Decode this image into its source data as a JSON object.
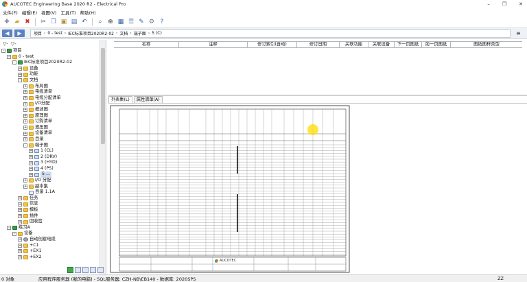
{
  "window": {
    "title": "AUCOTEC Engineering Base 2020 R2 - Electrical Pro",
    "controls": [
      "–",
      "❐",
      "✕"
    ]
  },
  "menu": [
    "文件(F)",
    "编辑(E)",
    "视图(V)",
    "工具(T)",
    "帮助(H)"
  ],
  "toolbar_icons": [
    "new-icon",
    "open-icon",
    "delete-icon",
    "cut-icon",
    "copy-icon",
    "paste-icon",
    "properties-icon",
    "undo-icon",
    "search-icon",
    "zoom-icon",
    "view-icon",
    "list-icon",
    "help-icon"
  ],
  "address": {
    "crumbs": [
      "项目",
      "0 - test",
      "IEC标准项目2020R2-02",
      "文档",
      "端子图",
      "5 (C)"
    ],
    "end_glyph": "≡"
  },
  "tree": {
    "toolbar": [
      "▽-",
      "▽-"
    ],
    "items": [
      {
        "label": "项目",
        "level": 0,
        "exp": "-",
        "icon": "proj"
      },
      {
        "label": "0 - test",
        "level": 1,
        "exp": "-",
        "icon": "folder"
      },
      {
        "label": "IEC标准项目2020R2-02",
        "level": 2,
        "exp": "-",
        "icon": "proj"
      },
      {
        "label": "设备",
        "level": 3,
        "exp": "+",
        "icon": "folder"
      },
      {
        "label": "功能",
        "level": 3,
        "exp": "+",
        "icon": "folder"
      },
      {
        "label": "文档",
        "level": 3,
        "exp": "-",
        "icon": "folder"
      },
      {
        "label": "布局图",
        "level": 4,
        "exp": "+",
        "icon": "folder"
      },
      {
        "label": "电缆清单",
        "level": 4,
        "exp": "+",
        "icon": "folder"
      },
      {
        "label": "电缆分配清单",
        "level": 4,
        "exp": "+",
        "icon": "folder"
      },
      {
        "label": "I/O分配",
        "level": 4,
        "exp": "+",
        "icon": "folder"
      },
      {
        "label": "概述图",
        "level": 4,
        "exp": "+",
        "icon": "folder"
      },
      {
        "label": "原理图",
        "level": 4,
        "exp": "+",
        "icon": "folder"
      },
      {
        "label": "订购清单",
        "level": 4,
        "exp": "+",
        "icon": "folder"
      },
      {
        "label": "液压图",
        "level": 4,
        "exp": "+",
        "icon": "folder"
      },
      {
        "label": "设备清单",
        "level": 4,
        "exp": "+",
        "icon": "folder"
      },
      {
        "label": "目录",
        "level": 4,
        "exp": "+",
        "icon": "folder"
      },
      {
        "label": "端子图",
        "level": 4,
        "exp": "-",
        "icon": "folder"
      },
      {
        "label": "1 (CL)",
        "level": 5,
        "exp": "+",
        "icon": "page"
      },
      {
        "label": "2 (DRV)",
        "level": 5,
        "exp": "+",
        "icon": "page"
      },
      {
        "label": "3 (HYD)",
        "level": 5,
        "exp": "+",
        "icon": "page"
      },
      {
        "label": "4 (PS)",
        "level": 5,
        "exp": "+",
        "icon": "page"
      },
      {
        "label": "5 ...",
        "level": 5,
        "exp": "+",
        "icon": "page",
        "selected": true
      },
      {
        "label": "I/O 分配",
        "level": 4,
        "exp": "+",
        "icon": "folder"
      },
      {
        "label": "副本集",
        "level": 4,
        "exp": "+",
        "icon": "folder"
      },
      {
        "label": "目录 1.1A",
        "level": 4,
        "exp": "",
        "icon": "doc"
      },
      {
        "label": "任务",
        "level": 3,
        "exp": "+",
        "icon": "folder"
      },
      {
        "label": "信息",
        "level": 3,
        "exp": "+",
        "icon": "folder"
      },
      {
        "label": "模板",
        "level": 3,
        "exp": "+",
        "icon": "folder"
      },
      {
        "label": "插件",
        "level": 3,
        "exp": "+",
        "icon": "folder"
      },
      {
        "label": "回收篮",
        "level": 3,
        "exp": "+",
        "icon": "folder"
      },
      {
        "label": "练习A",
        "level": 1,
        "exp": "-",
        "icon": "proj"
      },
      {
        "label": "设备",
        "level": 2,
        "exp": "-",
        "icon": "folder"
      },
      {
        "label": "自动创建电缆",
        "level": 3,
        "exp": "+",
        "icon": "gear"
      },
      {
        "label": "+C1",
        "level": 3,
        "exp": "+",
        "icon": "folder"
      },
      {
        "label": "+EX1",
        "level": 3,
        "exp": "+",
        "icon": "folder"
      },
      {
        "label": "+EX2",
        "level": 3,
        "exp": "+",
        "icon": "folder"
      }
    ]
  },
  "list": {
    "columns": [
      "名称",
      "注释",
      "修订索引(自动)",
      "修订日期",
      "关联功能",
      "关联设备",
      "下一页图纸",
      "前一页图纸",
      "图纸图样类型"
    ]
  },
  "tabs": [
    "列表集(L)",
    "属性清单(A)"
  ],
  "preview": {
    "logo_text": "AUCOTEC"
  },
  "status": {
    "left": "0 对象",
    "text": "应用程序服务器 (我的电脑) - SQL服务器: CZH-NB\\EB140 - 数据库: 2020SPS",
    "right": "ZZ"
  }
}
